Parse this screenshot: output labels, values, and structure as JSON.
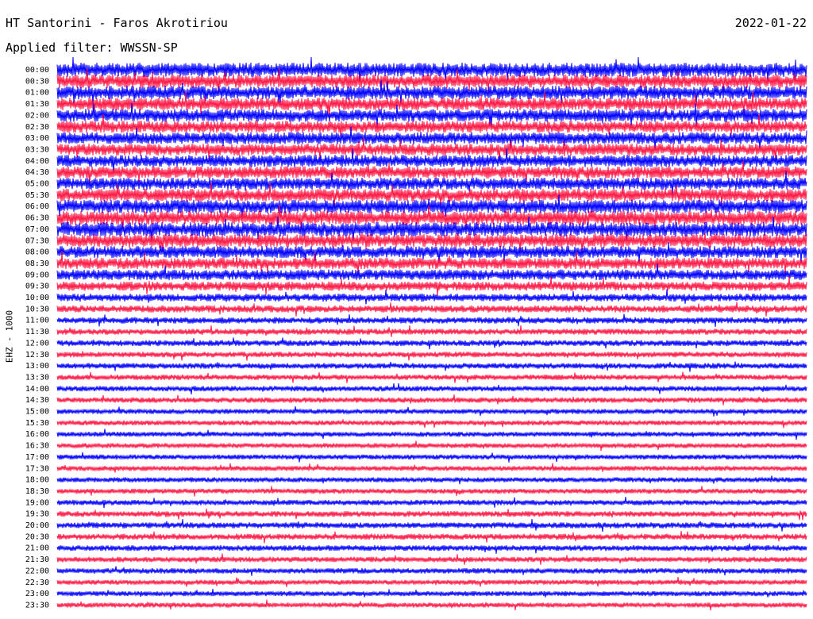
{
  "header": {
    "station": "HT Santorini - Faros Akrotiriou",
    "date": "2022-01-22",
    "filter": "Applied filter: WWSSN-SP"
  },
  "channel_label": "EHZ - 1000",
  "colors": {
    "trace_a": "#0000ff",
    "trace_b": "#ff1744",
    "background": "#ffffff",
    "text": "#000000"
  },
  "chart_data": {
    "type": "line",
    "y_tick_labels": [
      "00:00",
      "00:30",
      "01:00",
      "01:30",
      "02:00",
      "02:30",
      "03:00",
      "03:30",
      "04:00",
      "04:30",
      "05:00",
      "05:30",
      "06:00",
      "06:30",
      "07:00",
      "07:30",
      "08:00",
      "08:30",
      "09:00",
      "09:30",
      "10:00",
      "10:30",
      "11:00",
      "11:30",
      "12:00",
      "12:30",
      "13:00",
      "13:30",
      "14:00",
      "14:30",
      "15:00",
      "15:30",
      "16:00",
      "16:30",
      "17:00",
      "17:30",
      "18:00",
      "18:30",
      "19:00",
      "19:30",
      "20:00",
      "20:30",
      "21:00",
      "21:30",
      "22:00",
      "22:30",
      "23:00",
      "23:30"
    ],
    "series_colors": [
      "#0000ff",
      "#ff1744"
    ],
    "trace_amplitude": [
      1.0,
      0.95,
      0.95,
      0.9,
      0.9,
      0.85,
      0.85,
      0.85,
      0.85,
      0.85,
      0.85,
      0.9,
      0.95,
      1.0,
      1.0,
      0.95,
      0.85,
      0.8,
      0.75,
      0.65,
      0.55,
      0.5,
      0.45,
      0.42,
      0.42,
      0.4,
      0.4,
      0.38,
      0.38,
      0.38,
      0.35,
      0.35,
      0.35,
      0.35,
      0.35,
      0.35,
      0.35,
      0.35,
      0.38,
      0.4,
      0.42,
      0.42,
      0.4,
      0.38,
      0.38,
      0.35,
      0.35,
      0.35
    ],
    "grid": false,
    "legend": "none"
  }
}
